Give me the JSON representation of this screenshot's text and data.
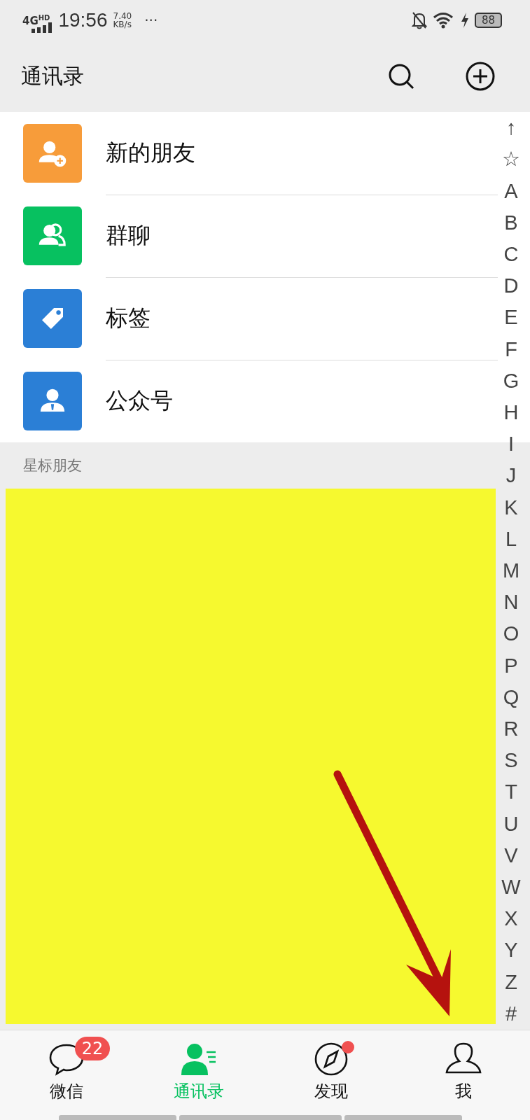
{
  "status_bar": {
    "network": "4G",
    "network_sub": "HD",
    "time": "19:56",
    "speed": "7.40",
    "speed_unit": "KB/s",
    "more": "···",
    "battery": "88"
  },
  "header": {
    "title": "通讯录"
  },
  "entries": [
    {
      "label": "新的朋友",
      "kind": "add-friend",
      "color": "#f79c3a"
    },
    {
      "label": "群聊",
      "kind": "group",
      "color": "#07c160"
    },
    {
      "label": "标签",
      "kind": "tag",
      "color": "#2b7fd6"
    },
    {
      "label": "公众号",
      "kind": "official",
      "color": "#2b7fd6"
    }
  ],
  "section": {
    "title": "星标朋友"
  },
  "index": [
    "↑",
    "☆",
    "A",
    "B",
    "C",
    "D",
    "E",
    "F",
    "G",
    "H",
    "I",
    "J",
    "K",
    "L",
    "M",
    "N",
    "O",
    "P",
    "Q",
    "R",
    "S",
    "T",
    "U",
    "V",
    "W",
    "X",
    "Y",
    "Z",
    "#"
  ],
  "tabs": [
    {
      "label": "微信",
      "kind": "chats",
      "selected": false,
      "badge": "22",
      "dot": false
    },
    {
      "label": "通讯录",
      "kind": "contacts",
      "selected": true,
      "dot": false
    },
    {
      "label": "发现",
      "kind": "discover",
      "selected": false,
      "dot": true
    },
    {
      "label": "我",
      "kind": "me",
      "selected": false,
      "dot": false
    }
  ]
}
